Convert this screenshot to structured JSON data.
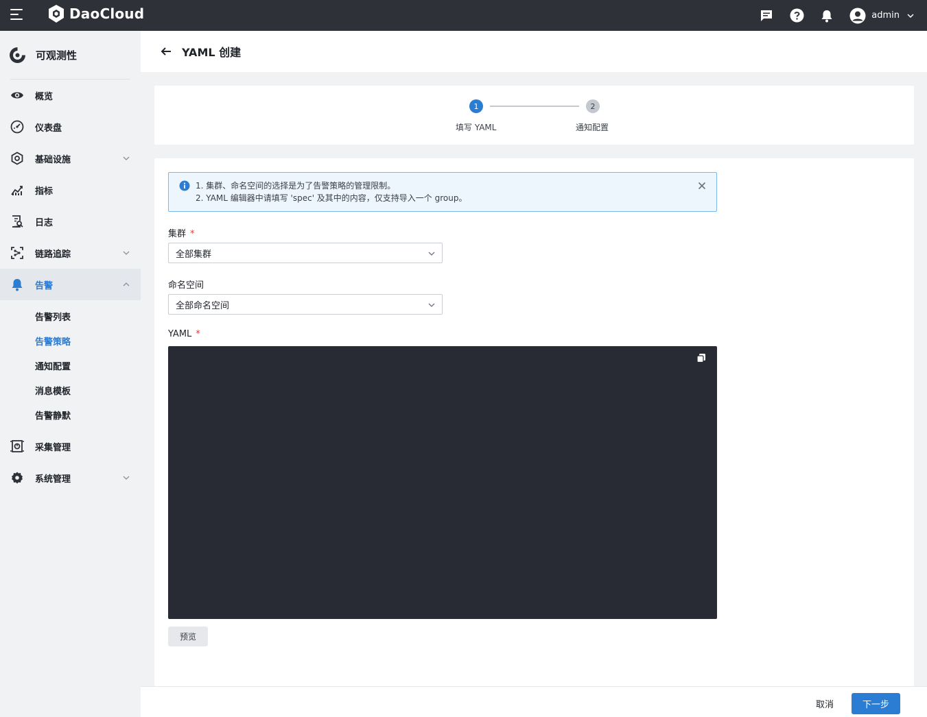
{
  "topbar": {
    "brand": "DaoCloud",
    "username": "admin",
    "icons": [
      "hamburger-icon",
      "message-icon",
      "help-icon",
      "bell-icon",
      "user-avatar-icon",
      "chevron-down-icon"
    ]
  },
  "sidebar": {
    "title": "可观测性",
    "items": [
      {
        "label": "概览",
        "icon": "eye-icon"
      },
      {
        "label": "仪表盘",
        "icon": "dashboard-icon"
      },
      {
        "label": "基础设施",
        "icon": "infrastructure-icon",
        "expandable": true
      },
      {
        "label": "指标",
        "icon": "metrics-icon"
      },
      {
        "label": "日志",
        "icon": "log-icon"
      },
      {
        "label": "链路追踪",
        "icon": "trace-icon",
        "expandable": true
      },
      {
        "label": "告警",
        "icon": "bell-icon",
        "expandable": true,
        "expanded": true,
        "active": true
      },
      {
        "label": "采集管理",
        "icon": "collection-icon"
      },
      {
        "label": "系统管理",
        "icon": "gear-icon",
        "expandable": true
      }
    ],
    "alert_sub_items": [
      {
        "label": "告警列表"
      },
      {
        "label": "告警策略",
        "active": true
      },
      {
        "label": "通知配置"
      },
      {
        "label": "消息模板"
      },
      {
        "label": "告警静默"
      }
    ]
  },
  "header": {
    "title": "YAML 创建"
  },
  "steps": [
    {
      "number": "1",
      "label": "填写 YAML",
      "status": "current"
    },
    {
      "number": "2",
      "label": "通知配置",
      "status": "pending"
    }
  ],
  "form": {
    "notice": {
      "line1": "1. 集群、命名空间的选择是为了告警策略的管理限制。",
      "line2": "2. YAML 编辑器中请填写 'spec' 及其中的内容，仅支持导入一个 group。"
    },
    "cluster": {
      "label": "集群",
      "required_mark": "*",
      "value": "全部集群"
    },
    "namespace": {
      "label": "命名空间",
      "value": "全部命名空间"
    },
    "yaml": {
      "label": "YAML",
      "required_mark": "*",
      "content": ""
    },
    "preview_label": "预览"
  },
  "footer": {
    "cancel_label": "取消",
    "next_label": "下一步"
  },
  "colors": {
    "primary": "#2b7cd3",
    "topbar": "#2e3138",
    "editor_bg": "#282b33",
    "required": "#e53935"
  }
}
